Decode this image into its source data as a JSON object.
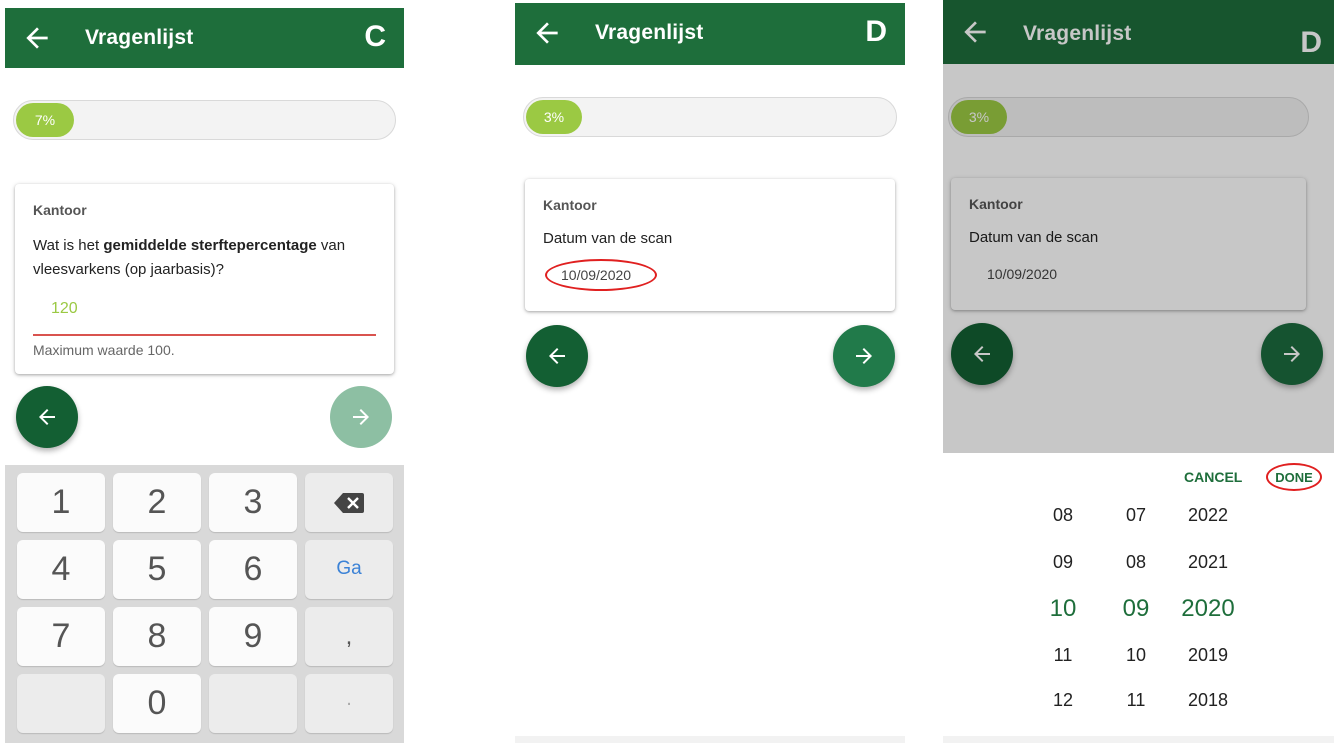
{
  "header": {
    "title": "Vragenlijst"
  },
  "panel_c": {
    "letter": "C",
    "progress": {
      "label": "7%",
      "value": 0.07
    },
    "card": {
      "section": "Kantoor",
      "question_prefix": "Wat is het ",
      "question_bold": "gemiddelde sterftepercentage",
      "question_suffix": " van vleesvarkens (op jaarbasis)?",
      "input_value": "120",
      "error": "Maximum waarde 100."
    },
    "keyboard": {
      "keys": [
        "1",
        "2",
        "3",
        "4",
        "5",
        "6",
        "7",
        "8",
        "9",
        "0"
      ],
      "go_label": "Ga",
      "comma": ",",
      "period": "."
    }
  },
  "panel_d1": {
    "letter": "D",
    "progress": {
      "label": "3%",
      "value": 0.03
    },
    "card": {
      "section": "Kantoor",
      "question": "Datum van de scan",
      "date": "10/09/2020"
    }
  },
  "panel_d2": {
    "letter": "D",
    "progress": {
      "label": "3%",
      "value": 0.03
    },
    "card": {
      "section": "Kantoor",
      "question": "Datum van de scan",
      "date": "10/09/2020"
    },
    "picker": {
      "cancel_label": "CANCEL",
      "done_label": "DONE",
      "days": [
        "08",
        "09",
        "10",
        "11",
        "12"
      ],
      "months": [
        "07",
        "08",
        "09",
        "10",
        "11"
      ],
      "years": [
        "2022",
        "2021",
        "2020",
        "2019",
        "2018"
      ],
      "selected_index": 2
    }
  },
  "colors": {
    "header": "#1e6e3b",
    "progress": "#9bc943",
    "fab_dark": "#135f33",
    "fab_disabled": "#8dbfa3",
    "annotation": "#e02020"
  }
}
